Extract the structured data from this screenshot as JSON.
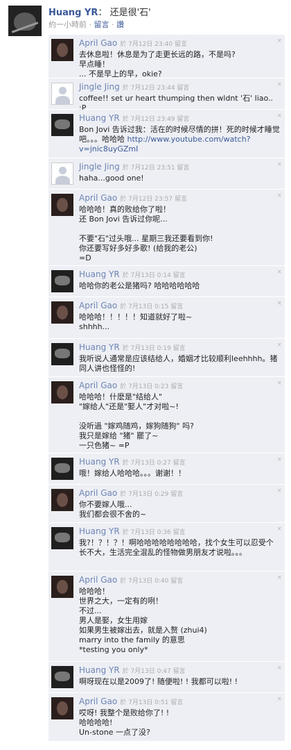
{
  "post": {
    "author": "Huang YR",
    "separator": "：",
    "status": "还是很'石'",
    "time": "約一小時前",
    "dot": " · ",
    "comment_link": "留言",
    "like_link": "讚"
  },
  "comments": [
    {
      "author": "April Gao",
      "avatar": "april",
      "date": "於 7月12日 23:40",
      "action": "留言",
      "text": "去休息啦！休息是为了走更长远的路，不是吗?\n早点睡！\n... 不是早上的早，okie?"
    },
    {
      "author": "Jingle Jing",
      "avatar": "jingle",
      "date": "於 7月12日 23:44",
      "action": "留言",
      "text": "coffee!! set ur heart thumping then wldnt '石' liao.. :P"
    },
    {
      "author": "Huang YR",
      "avatar": "huang",
      "date": "於 7月12日 23:49",
      "action": "留言",
      "text": "Bon Jovi 告诉过我：活在的时候尽情的拼！死的时候才睡觉吧。。。哈哈哈",
      "url": "http://www.youtube.com/watch?v=jnic8uyGZmI"
    },
    {
      "author": "Jingle Jing",
      "avatar": "jingle",
      "date": "於 7月12日 23:51",
      "action": "留言",
      "text": "haha...good one!"
    },
    {
      "author": "April Gao",
      "avatar": "april",
      "date": "於 7月12日 23:57",
      "action": "留言",
      "text": "哈哈哈！真的败给你了啦！\n还 Bon Jovi 告诉过你呢...\n\n不要\"石\"过头哦... 星期三我还要看到你!\n你还要写好多好多歌! (给我的老公)\n=D"
    },
    {
      "author": "Huang YR",
      "avatar": "huang",
      "date": "於 7月13日 0:14",
      "action": "留言",
      "text": "哈哈你的老公是猪吗? 哈哈哈哈哈哈"
    },
    {
      "author": "April Gao",
      "avatar": "april",
      "date": "於 7月13日 0:15",
      "action": "留言",
      "text": "哈哈哈！！！！！知道就好了啦~\nshhhh..."
    },
    {
      "author": "Huang YR",
      "avatar": "huang",
      "date": "於 7月13日 0:19",
      "action": "留言",
      "text": "我听说人通常是应该结给人，婚姻才比较顺利leehhhh。猪同人讲也怪怪的!"
    },
    {
      "author": "April Gao",
      "avatar": "april",
      "date": "於 7月13日 0:23",
      "action": "留言",
      "text": "哈哈哈！什麽是\"结给人\"\n\"嫁给人\"还是\"娶人\"才对啦~!\n\n没听過 \"嫁鸡随鸡，嫁狗随狗\" 吗?\n我只是嫁给 \"猪\" 罷了~\n一只色猪~ =P"
    },
    {
      "author": "Huang YR",
      "avatar": "huang",
      "date": "於 7月13日 0:27",
      "action": "留言",
      "text": "哦！嫁给人哈哈哈。。。谢谢！！"
    },
    {
      "author": "April Gao",
      "avatar": "april",
      "date": "於 7月13日 0:29",
      "action": "留言",
      "text": "你不要嫁人哦...\n我们都会很不舍的~"
    },
    {
      "author": "Huang YR",
      "avatar": "huang",
      "date": "於 7月13日 0:36",
      "action": "留言",
      "text": "我?！？！？！啊哈哈哈哈哈哈哈哈，找个女生可以忍受个长不大，生活完全混乱的怪物做男朋友才说啦。。。"
    },
    {
      "author": "April Gao",
      "avatar": "april",
      "date": "於 7月13日 0:40",
      "action": "留言",
      "text": "哈哈哈！\n世界之大，一定有的咧！\n不过...\n男人是娶，女生用嫁\n如果男生被嫁出去，就是入赘 (zhui4)\nmarry into the family 的意思\n*testing you only*"
    },
    {
      "author": "Huang YR",
      "avatar": "huang",
      "date": "於 7月13日 0:47",
      "action": "留言",
      "text": "啊呀现在以是2009了! 随便啦! ! 我都可以啦! !"
    },
    {
      "author": "April Gao",
      "avatar": "april",
      "date": "於 7月13日 0:51",
      "action": "留言",
      "text": "哎呀! 我整个是败给你了! !\n哈哈哈哈!\nUn-stone 一点了没?"
    }
  ]
}
